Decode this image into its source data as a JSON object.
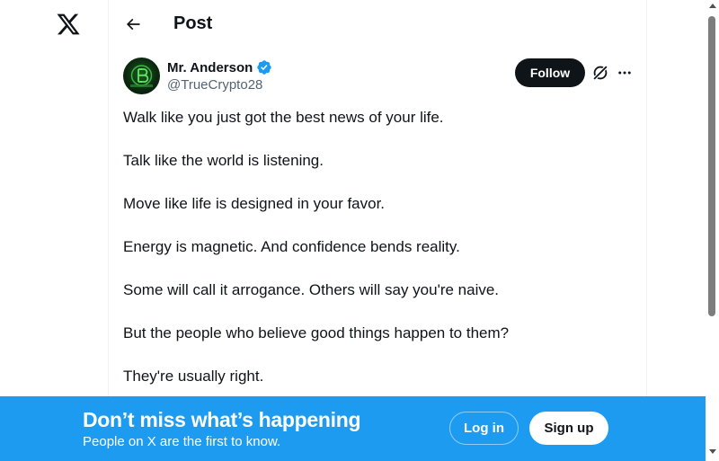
{
  "nav": {
    "logo_icon": "x-logo-icon"
  },
  "header": {
    "title": "Post",
    "back_icon": "arrow-left-icon"
  },
  "post": {
    "author": {
      "display_name": "Mr. Anderson",
      "handle": "@TrueCrypto28",
      "verified": true,
      "avatar_icon": "bitcoin-avatar",
      "verified_color": "#1d9bf0"
    },
    "follow_label": "Follow",
    "grok_icon": "grok-icon",
    "more_icon": "more-horizontal-icon",
    "lines": [
      "Walk like you just got the best news of your life.",
      "Talk like the world is listening.",
      "Move like life is designed in your favor.",
      "Energy is magnetic. And confidence bends reality.",
      "Some will call it arrogance. Others will say you're naive.",
      "But the people who believe good things happen to them?",
      "They're usually right."
    ]
  },
  "banner": {
    "title": "Don’t miss what’s happening",
    "subtitle": "People on X are the first to know.",
    "login_label": "Log in",
    "signup_label": "Sign up",
    "background": "#1d9bf0"
  }
}
